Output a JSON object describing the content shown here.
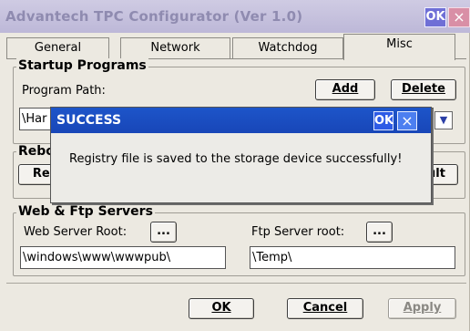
{
  "window": {
    "title": "Advantech TPC Configurator (Ver 1.0)",
    "ok_label": "OK",
    "close_glyph": "×"
  },
  "tabs": [
    {
      "label": "General"
    },
    {
      "label": "Network"
    },
    {
      "label": "Watchdog"
    },
    {
      "label": "Misc",
      "active": true
    }
  ],
  "startup": {
    "title": "Startup Programs",
    "path_label": "Program Path:",
    "add_label": "Add",
    "delete_label": "Delete",
    "path_value_visible": "\\Har"
  },
  "reboot": {
    "title_visible": "Rebo",
    "left_button_visible": "Reb",
    "right_button_visible": "ult"
  },
  "servers": {
    "title": "Web & Ftp Servers",
    "web_label": "Web Server Root:",
    "ftp_label": "Ftp Server root:",
    "browse_label": "...",
    "web_value": "\\windows\\www\\wwwpub\\",
    "ftp_value": "\\Temp\\"
  },
  "footer": {
    "ok_label": "OK",
    "cancel_label": "Cancel",
    "apply_label": "Apply"
  },
  "dialog": {
    "title": "SUCCESS",
    "ok_label": "OK",
    "close_glyph": "×",
    "message": "Registry file is saved to the storage device successfully!"
  },
  "icons": {
    "dropdown": "chevron-down-icon",
    "close": "close-icon"
  }
}
